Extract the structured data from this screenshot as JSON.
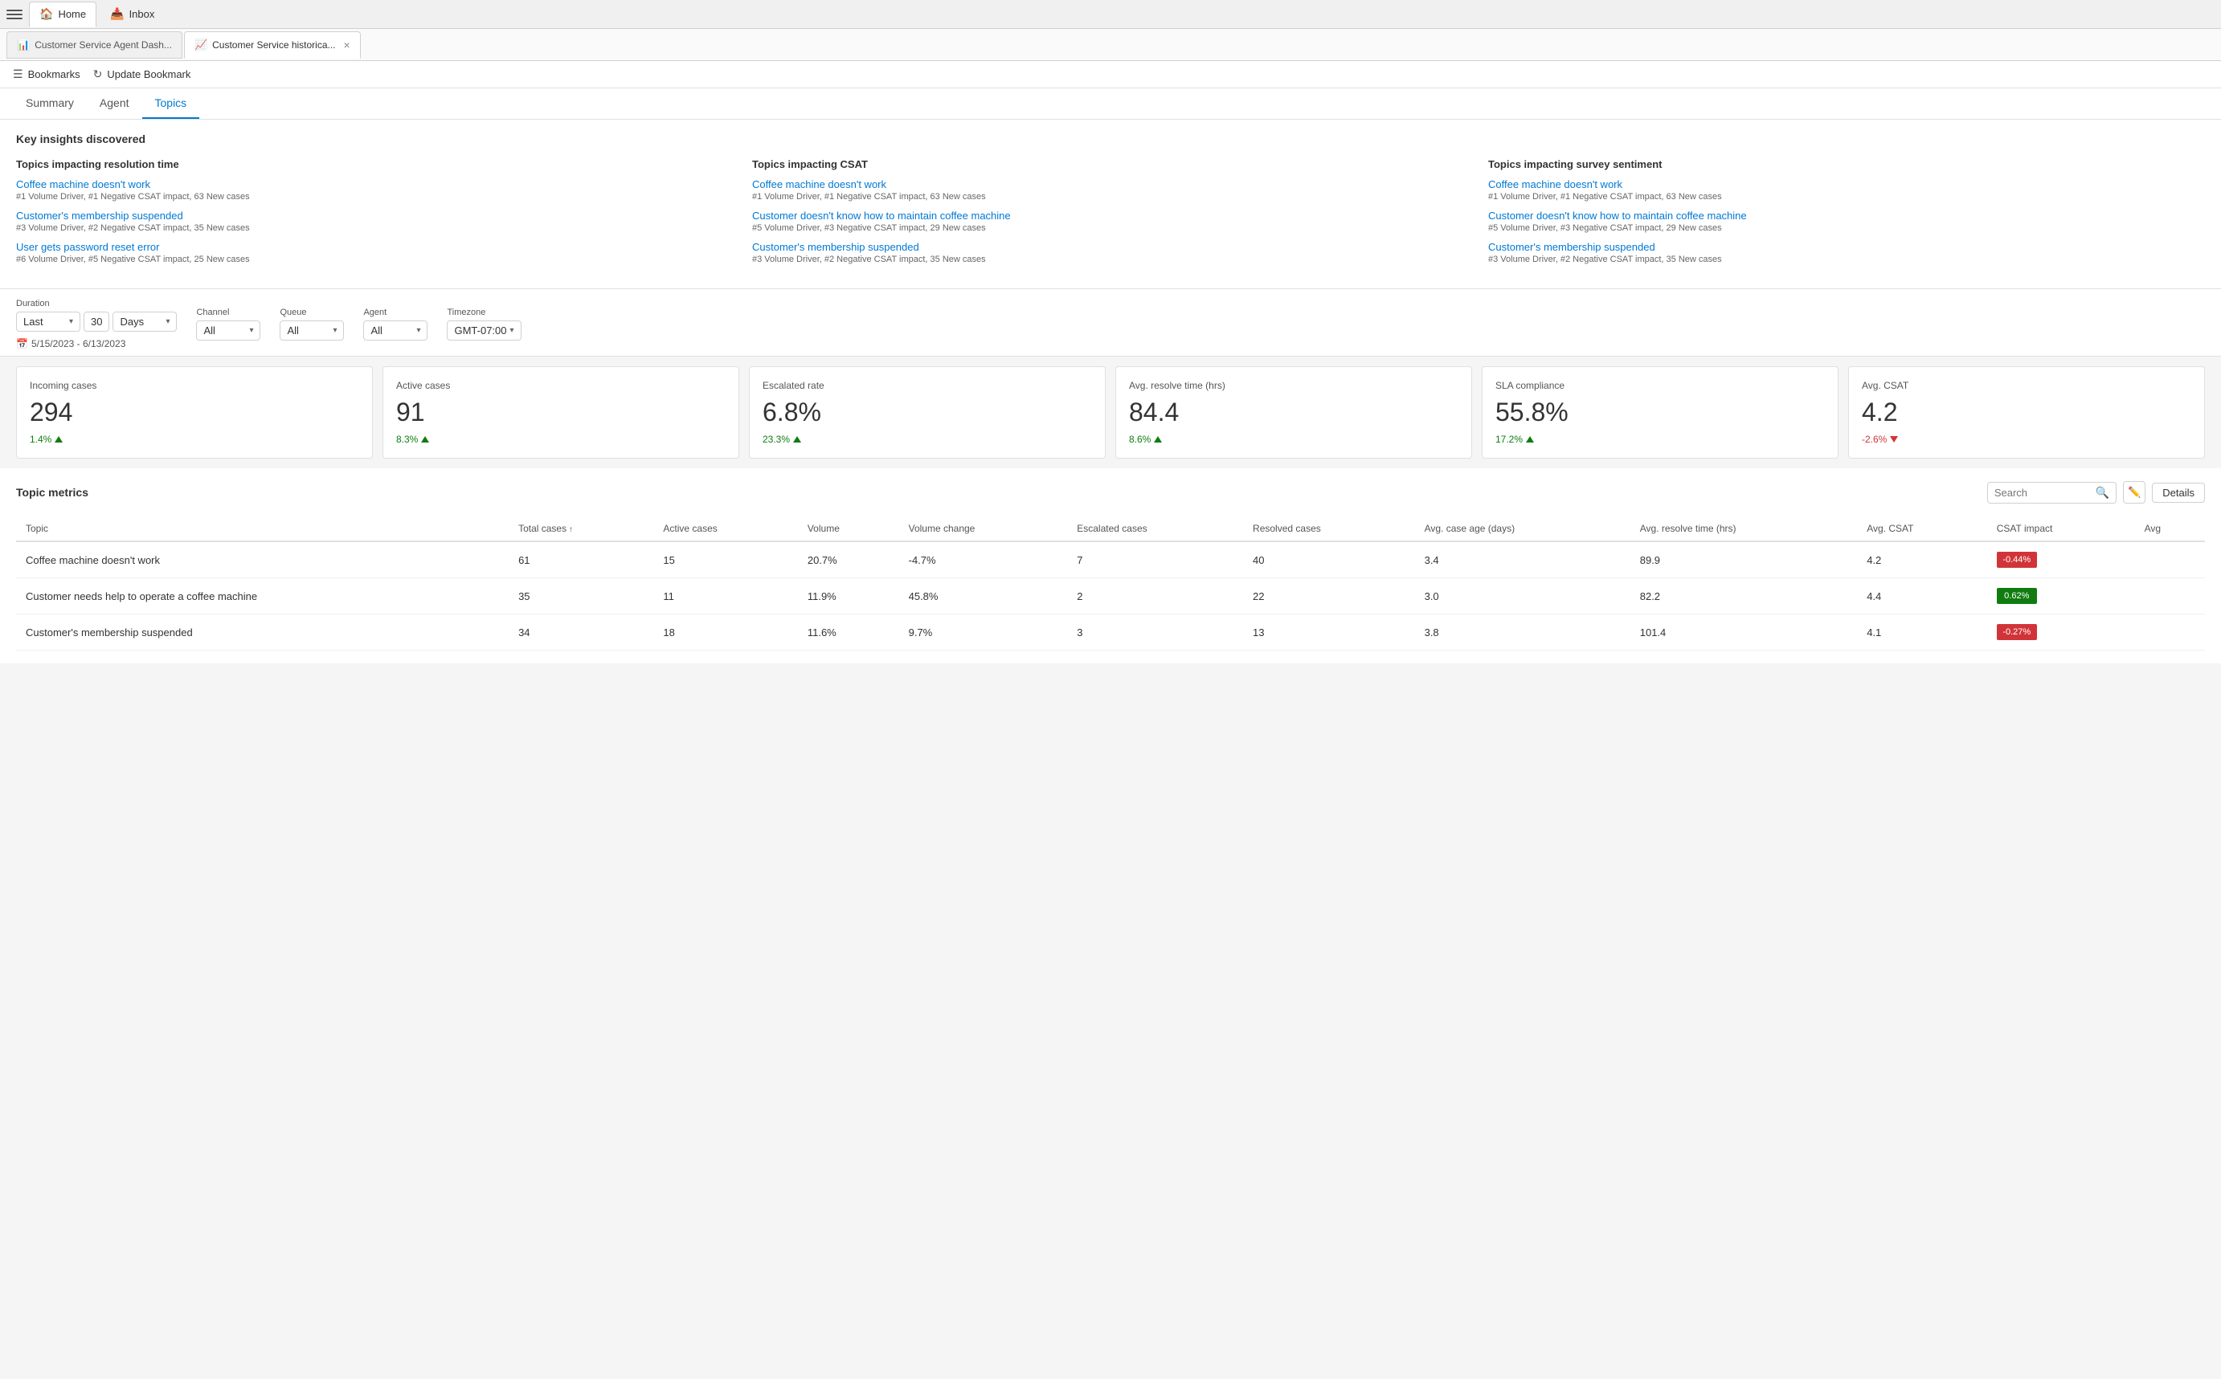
{
  "topBar": {
    "hamburger_label": "Menu",
    "tabs": [
      {
        "id": "home",
        "label": "Home",
        "icon": "🏠",
        "active": true
      },
      {
        "id": "inbox",
        "label": "Inbox",
        "icon": "📥",
        "active": false
      }
    ]
  },
  "pageTabs": [
    {
      "id": "dash",
      "label": "Customer Service Agent Dash...",
      "icon": "📊",
      "active": false,
      "closable": false
    },
    {
      "id": "historical",
      "label": "Customer Service historica...",
      "icon": "📈",
      "active": true,
      "closable": true
    }
  ],
  "bookmarksBar": {
    "bookmarks_label": "Bookmarks",
    "update_label": "Update Bookmark"
  },
  "mainTabs": [
    {
      "id": "summary",
      "label": "Summary",
      "active": false
    },
    {
      "id": "agent",
      "label": "Agent",
      "active": false
    },
    {
      "id": "topics",
      "label": "Topics",
      "active": true
    }
  ],
  "keyInsights": {
    "title": "Key insights discovered",
    "sections": [
      {
        "id": "resolution",
        "heading": "Topics impacting resolution time",
        "items": [
          {
            "link": "Coffee machine doesn't work",
            "meta": "#1 Volume Driver, #1 Negative CSAT impact, 63 New cases"
          },
          {
            "link": "Customer's membership suspended",
            "meta": "#3 Volume Driver, #2 Negative CSAT impact, 35 New cases"
          },
          {
            "link": "User gets password reset error",
            "meta": "#6 Volume Driver, #5 Negative CSAT impact, 25 New cases"
          }
        ]
      },
      {
        "id": "csat",
        "heading": "Topics impacting CSAT",
        "items": [
          {
            "link": "Coffee machine doesn't work",
            "meta": "#1 Volume Driver, #1 Negative CSAT impact, 63 New cases"
          },
          {
            "link": "Customer doesn't know how to maintain coffee machine",
            "meta": "#5 Volume Driver, #3 Negative CSAT impact, 29 New cases"
          },
          {
            "link": "Customer's membership suspended",
            "meta": "#3 Volume Driver, #2 Negative CSAT impact, 35 New cases"
          }
        ]
      },
      {
        "id": "sentiment",
        "heading": "Topics impacting survey sentiment",
        "items": [
          {
            "link": "Coffee machine doesn't work",
            "meta": "#1 Volume Driver, #1 Negative CSAT impact, 63 New cases"
          },
          {
            "link": "Customer doesn't know how to maintain coffee machine",
            "meta": "#5 Volume Driver, #3 Negative CSAT impact, 29 New cases"
          },
          {
            "link": "Customer's membership suspended",
            "meta": "#3 Volume Driver, #2 Negative CSAT impact, 35 New cases"
          }
        ]
      }
    ]
  },
  "filters": {
    "duration_label": "Duration",
    "duration_prefix": "Last",
    "duration_value": "30",
    "duration_unit": "Days",
    "channel_label": "Channel",
    "channel_value": "All",
    "queue_label": "Queue",
    "queue_value": "All",
    "agent_label": "Agent",
    "agent_value": "All",
    "timezone_label": "Timezone",
    "timezone_value": "GMT-07:00",
    "date_range_icon": "📅",
    "date_range": "5/15/2023 - 6/13/2023"
  },
  "metrics": [
    {
      "id": "incoming",
      "title": "Incoming cases",
      "value": "294",
      "change": "1.4%",
      "direction": "up"
    },
    {
      "id": "active",
      "title": "Active cases",
      "value": "91",
      "change": "8.3%",
      "direction": "up"
    },
    {
      "id": "escalated",
      "title": "Escalated rate",
      "value": "6.8%",
      "change": "23.3%",
      "direction": "up"
    },
    {
      "id": "resolve",
      "title": "Avg. resolve time (hrs)",
      "value": "84.4",
      "change": "8.6%",
      "direction": "up"
    },
    {
      "id": "sla",
      "title": "SLA compliance",
      "value": "55.8%",
      "change": "17.2%",
      "direction": "up"
    },
    {
      "id": "csat",
      "title": "Avg. CSAT",
      "value": "4.2",
      "change": "-2.6%",
      "direction": "down"
    }
  ],
  "topicMetrics": {
    "title": "Topic metrics",
    "search_placeholder": "Search",
    "details_label": "Details",
    "columns": [
      "Topic",
      "Total cases",
      "Active cases",
      "Volume",
      "Volume change",
      "Escalated cases",
      "Resolved cases",
      "Avg. case age (days)",
      "Avg. resolve time (hrs)",
      "Avg. CSAT",
      "CSAT impact",
      "Avg"
    ],
    "rows": [
      {
        "topic": "Coffee machine doesn't work",
        "total_cases": "61",
        "active_cases": "15",
        "volume": "20.7%",
        "volume_change": "-4.7%",
        "escalated_cases": "7",
        "resolved_cases": "40",
        "avg_case_age": "3.4",
        "avg_resolve_time": "89.9",
        "avg_csat": "4.2",
        "csat_impact": "-0.44%",
        "csat_impact_color": "red"
      },
      {
        "topic": "Customer needs help to operate a coffee machine",
        "total_cases": "35",
        "active_cases": "11",
        "volume": "11.9%",
        "volume_change": "45.8%",
        "escalated_cases": "2",
        "resolved_cases": "22",
        "avg_case_age": "3.0",
        "avg_resolve_time": "82.2",
        "avg_csat": "4.4",
        "csat_impact": "0.62%",
        "csat_impact_color": "green"
      },
      {
        "topic": "Customer's membership suspended",
        "total_cases": "34",
        "active_cases": "18",
        "volume": "11.6%",
        "volume_change": "9.7%",
        "escalated_cases": "3",
        "resolved_cases": "13",
        "avg_case_age": "3.8",
        "avg_resolve_time": "101.4",
        "avg_csat": "4.1",
        "csat_impact": "-0.27%",
        "csat_impact_color": "red"
      }
    ]
  }
}
